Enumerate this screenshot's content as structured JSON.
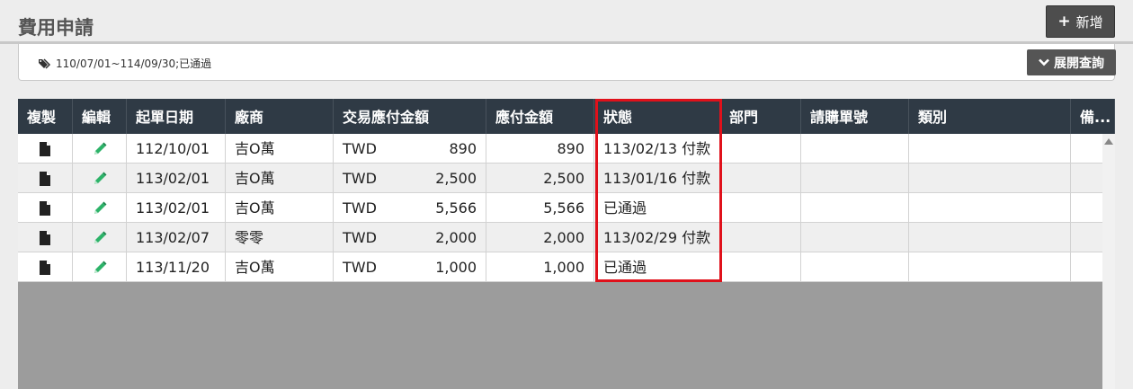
{
  "header": {
    "title": "費用申請",
    "add_button": {
      "icon": "+",
      "label": "新增"
    }
  },
  "filter": {
    "icon": "tag-icon",
    "text": "110/07/01~114/09/30;已通過",
    "expand_button": {
      "icon": "chevron-down-icon",
      "label": "展開查詢"
    }
  },
  "table": {
    "columns": [
      "複製",
      "編輯",
      "起單日期",
      "廠商",
      "交易應付金額",
      "應付金額",
      "狀態",
      "部門",
      "請購單號",
      "類別",
      "備..."
    ],
    "rows": [
      {
        "date": "112/10/01",
        "vendor": "吉O萬",
        "currency": "TWD",
        "trade_amount": "890",
        "payable": "890",
        "status": "113/02/13 付款",
        "dept": "",
        "po": "",
        "category": "",
        "note": ""
      },
      {
        "date": "113/02/01",
        "vendor": "吉O萬",
        "currency": "TWD",
        "trade_amount": "2,500",
        "payable": "2,500",
        "status": "113/01/16 付款",
        "dept": "",
        "po": "",
        "category": "",
        "note": ""
      },
      {
        "date": "113/02/01",
        "vendor": "吉O萬",
        "currency": "TWD",
        "trade_amount": "5,566",
        "payable": "5,566",
        "status": "已通過",
        "dept": "",
        "po": "",
        "category": "",
        "note": ""
      },
      {
        "date": "113/02/07",
        "vendor": "零零",
        "currency": "TWD",
        "trade_amount": "2,000",
        "payable": "2,000",
        "status": "113/02/29 付款",
        "dept": "",
        "po": "",
        "category": "",
        "note": ""
      },
      {
        "date": "113/11/20",
        "vendor": "吉O萬",
        "currency": "TWD",
        "trade_amount": "1,000",
        "payable": "1,000",
        "status": "已通過",
        "dept": "",
        "po": "",
        "category": "",
        "note": ""
      }
    ],
    "row_icons": {
      "copy": "document-icon",
      "edit": "pencil-icon"
    }
  },
  "colors": {
    "header_bg": "#2f3a45",
    "highlight": "#e0111b",
    "edit_icon": "#2db369",
    "button_bg": "#4d4d4d"
  }
}
